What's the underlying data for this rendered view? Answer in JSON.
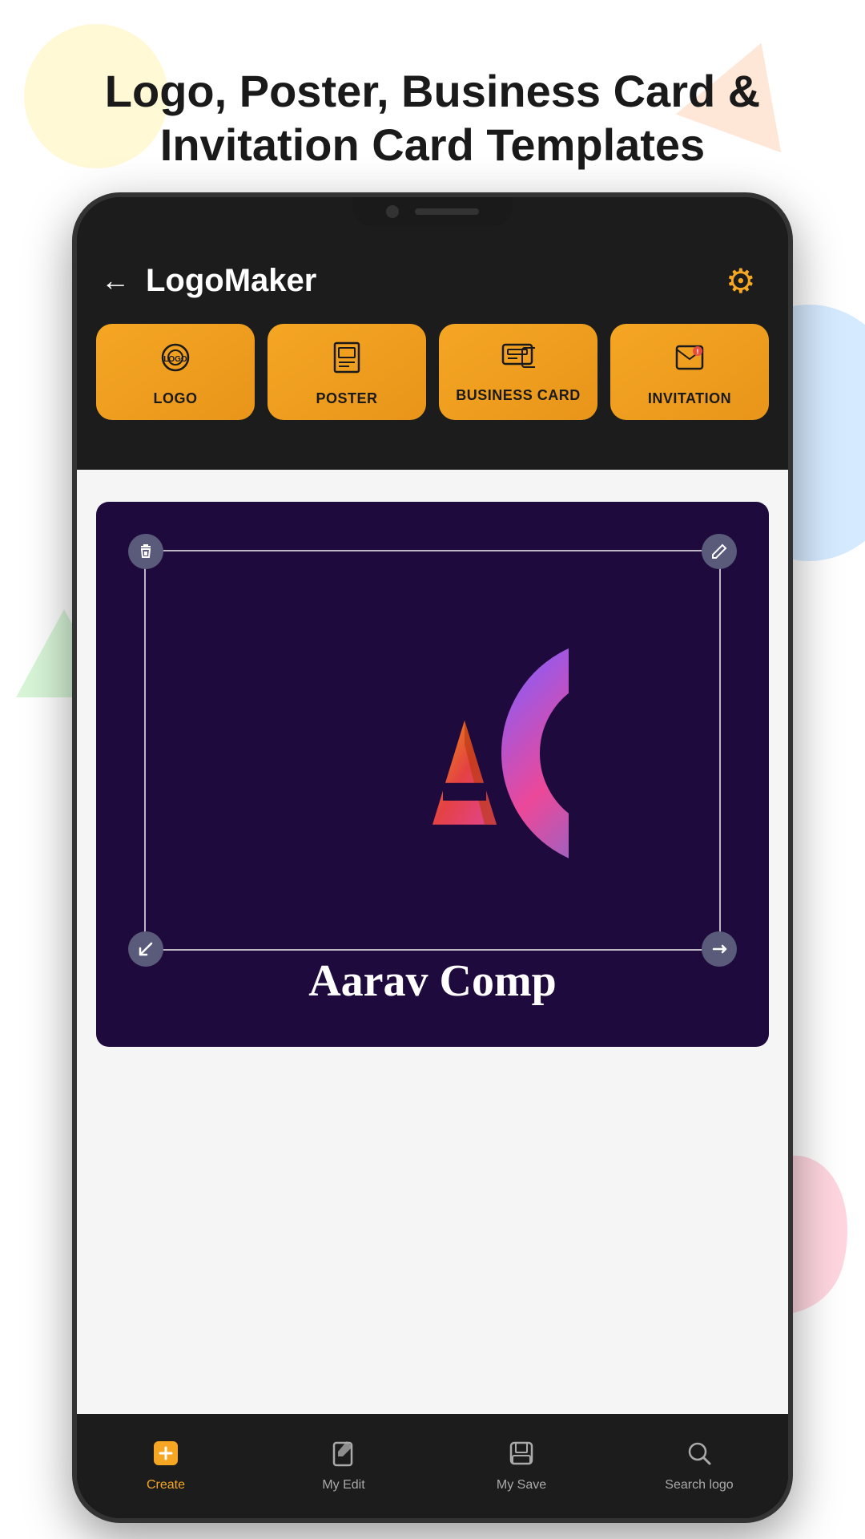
{
  "header": {
    "title_line1": "Logo, Poster, Business Card &",
    "title_line2": "Invitation Card Templates"
  },
  "nav": {
    "back_label": "←",
    "app_title": "LogoMaker",
    "settings_icon": "⚙"
  },
  "categories": [
    {
      "id": "logo",
      "label": "LOGO",
      "icon": "◎"
    },
    {
      "id": "poster",
      "label": "POSTER",
      "icon": "🖼"
    },
    {
      "id": "business_card",
      "label": "BUSINESS CARD",
      "icon": "💳"
    },
    {
      "id": "invitation",
      "label": "INVITATION",
      "icon": "🎫"
    }
  ],
  "canvas": {
    "company_name": "Aarav Comp",
    "background_color": "#1e0a3c"
  },
  "bottom_nav": [
    {
      "id": "create",
      "label": "Create",
      "icon": "➕",
      "active": true
    },
    {
      "id": "my_edit",
      "label": "My Edit",
      "icon": "✏",
      "active": false
    },
    {
      "id": "my_save",
      "label": "My Save",
      "icon": "📋",
      "active": false
    },
    {
      "id": "search_logo",
      "label": "Search logo",
      "icon": "🔍",
      "active": false
    }
  ],
  "handles": {
    "tl_icon": "🗑",
    "tr_icon": "✏",
    "bl_icon": "↙",
    "br_icon": "⟷"
  }
}
